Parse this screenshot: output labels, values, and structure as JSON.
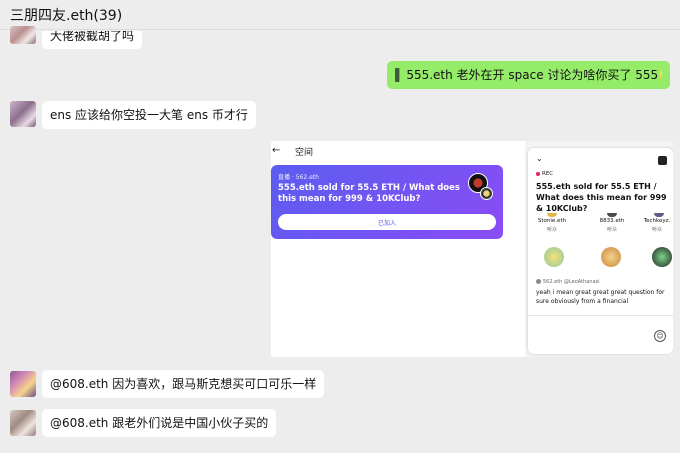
{
  "chat": {
    "title": "三朋四友.eth(39)"
  },
  "messages": [
    {
      "side": "left",
      "text": "大佬被截胡了吗"
    },
    {
      "side": "right",
      "text": "555.eth 老外在开 space 讨论为啥你买了 555"
    },
    {
      "side": "left",
      "text": "ens 应该给你空投一大笔 ens 币才行"
    },
    {
      "side": "left",
      "text": "@608.eth 因为喜欢，跟马斯克想买可口可乐一样"
    },
    {
      "side": "left",
      "text": "@608.eth 跟老外们说是中国小伙子买的"
    }
  ],
  "space_screenshot": {
    "left": {
      "back_icon": "←",
      "title": "空间",
      "card": {
        "live_label": "直播 · 562.eth",
        "topic": "555.eth sold for 55.5 ETH / What does this mean for 999 & 10KClub?",
        "join_label": "已加入"
      }
    },
    "right": {
      "chevron": "⌄",
      "rec_label": "REC",
      "topic": "555.eth sold for 55.5 ETH / What does this mean for 999 & 10KClub?",
      "speakers": [
        {
          "name": "Stonie.eth",
          "role": "听众"
        },
        {
          "name": "8833.eth",
          "role": "听众"
        },
        {
          "name": "Techkeyz.",
          "role": "听众"
        }
      ],
      "reply_handle": "562.eth @LeoAthanasi",
      "reply_text": "yeah i mean great great great question for sure obviously from a financial",
      "mic_icon": "☺"
    }
  },
  "colors": {
    "self_bubble": "#95ec69",
    "other_bubble": "#ffffff",
    "card_gradient_start": "#5a5df0",
    "card_gradient_end": "#8b4cf5"
  }
}
